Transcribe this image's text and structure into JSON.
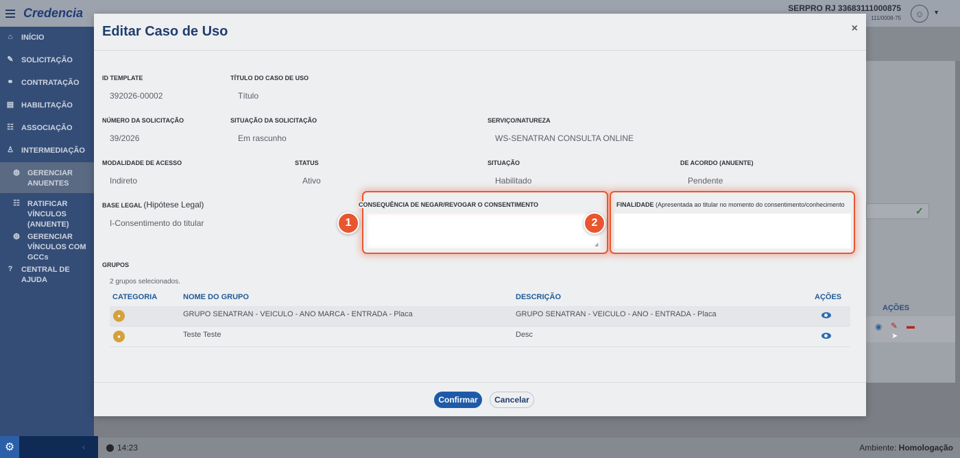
{
  "app": {
    "brand": "Credencia",
    "org_name": "SERPRO RJ 33683111000875",
    "org_cnpj": "111/0008-75",
    "time": "14:23",
    "env_label": "Ambiente:",
    "env_value": "Homologação"
  },
  "sidebar": {
    "items": [
      {
        "label": "INÍCIO",
        "icon": "home-icon"
      },
      {
        "label": "SOLICITAÇÃO",
        "icon": "file-edit-icon"
      },
      {
        "label": "CONTRATAÇÃO",
        "icon": "handshake-icon"
      },
      {
        "label": "HABILITAÇÃO",
        "icon": "id-card-icon"
      },
      {
        "label": "ASSOCIAÇÃO",
        "icon": "users-icon"
      },
      {
        "label": "INTERMEDIAÇÃO",
        "icon": "user-tie-icon"
      },
      {
        "label": "GERENCIAR ANUENTES",
        "icon": "globe-icon"
      },
      {
        "label": "RATIFICAR VÍNCULOS (ANUENTE)",
        "icon": "users-icon"
      },
      {
        "label": "GERENCIAR VÍNCULOS COM GCCs",
        "icon": "globe-icon"
      },
      {
        "label": "CENTRAL DE AJUDA",
        "icon": "question-icon"
      }
    ]
  },
  "background": {
    "acoes_header": "AÇÕES"
  },
  "modal": {
    "title": "Editar Caso de Uso",
    "close": "×",
    "fields": {
      "id_template": {
        "label": "ID TEMPLATE",
        "value": "392026-00002"
      },
      "titulo": {
        "label": "TÍTULO DO CASO DE USO",
        "value": "Título"
      },
      "numero": {
        "label": "NÚMERO DA SOLICITAÇÃO",
        "value": "39/2026"
      },
      "situacao_solicitacao": {
        "label": "SITUAÇÃO DA SOLICITAÇÃO",
        "value": "Em rascunho"
      },
      "servico": {
        "label": "SERVIÇO/NATUREZA",
        "value": "WS-SENATRAN CONSULTA ONLINE"
      },
      "modalidade": {
        "label": "MODALIDADE DE ACESSO",
        "value": "Indireto"
      },
      "status": {
        "label": "STATUS",
        "value": "Ativo"
      },
      "situacao": {
        "label": "SITUAÇÃO",
        "value": "Habilitado"
      },
      "de_acordo": {
        "label": "DE ACORDO (ANUENTE)",
        "value": "Pendente"
      },
      "base_legal": {
        "label": "BASE LEGAL",
        "label_note": "(Hipótese Legal)",
        "value": "I-Consentimento do titular"
      },
      "consequencia": {
        "label": "CONSEQUÊNCIA DE NEGAR/REVOGAR O CONSENTIMENTO",
        "value": ""
      },
      "finalidade": {
        "label": "FINALIDADE",
        "label_note": "(Apresentada ao titular no momento do consentimento/conhecimento",
        "value": ""
      }
    },
    "annotations": [
      "1",
      "2"
    ],
    "grupos": {
      "label": "GRUPOS",
      "selected_text": "2 grupos selecionados.",
      "columns": [
        "CATEGORIA",
        "NOME DO GRUPO",
        "DESCRIÇÃO",
        "AÇÕES"
      ],
      "rows": [
        {
          "nome": "GRUPO SENATRAN - VEICULO - ANO MARCA - ENTRADA - Placa",
          "descricao": "GRUPO SENATRAN - VEICULO - ANO - ENTRADA - Placa"
        },
        {
          "nome": "Teste Teste",
          "descricao": "Desc"
        }
      ]
    },
    "buttons": {
      "confirm": "Confirmar",
      "cancel": "Cancelar"
    }
  },
  "colors": {
    "sidebar": "#0f2a55",
    "primary": "#1f5aa8",
    "highlight": "#e8562f"
  }
}
